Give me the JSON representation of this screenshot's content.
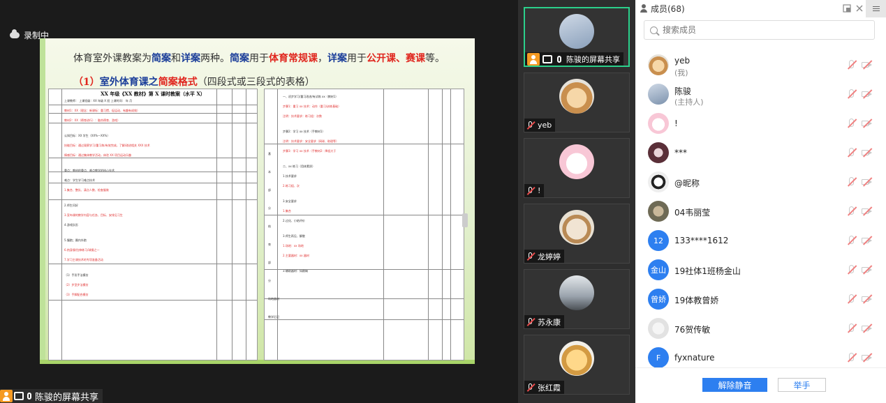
{
  "recording": {
    "label": "录制中"
  },
  "slide": {
    "line1": {
      "p1": "体育室外课教案为",
      "p2": "简案",
      "p3": "和",
      "p4": "详案",
      "p5": "两种。",
      "p6": "简案",
      "p7": "用于",
      "p8": "体育常规课",
      "p9": "，",
      "p10": "详案",
      "p11": "用于",
      "p12": "公开课、赛课",
      "p13": "等。"
    },
    "line2": {
      "p1": "（1）",
      "p2": "室外体育课之",
      "p3": "简案格式",
      "p4": "（四段式或三段式的表格）"
    },
    "doc_left_title": "XX 年级《XX 教材》第 X 课时教案（水平 X）",
    "doc_left_lines": [
      "上课教师：          上课班级：XX 年级 X 班          上课时间：   年   月",
      "教材1：XX（理念：新课标：重习惯、促运动、有趣有成效）",
      "教材2：XX（德育进行）：融合德育、游戏）",
      "认知目标：XX 学生（XX%—XX%）",
      "技能目标：通过观察学习/重习练/有效完成，了解/改进相关 XXX 技术",
      "情感目标：通过集体教学活动，体验 XX 项目运动乐趣",
      "重点：教材的重点、难点教学的核心技术",
      "难点：学生学习难点技术",
      "1.集合、整队、清点人数、检查服装",
      "2.师生问好",
      "3.宣布课的教学内容与任务、目标、安排见习生",
      "4.游戏队形",
      "5.慢跑；圈内外跑",
      "6.热身操/拉伸练习/球操之一",
      "7.学习主课技术的专项准备活动",
      "（1）手形手法模仿",
      "（2）步型步法模仿",
      "（3）手脚配合模仿"
    ],
    "doc_right_lines": [
      "一、初步学习/重习改进/有试练 xx（教材1）",
      "步骤1：重习 xx 技术：动作（重习/训练基础）",
      "注明：技术要求：练习组：次数",
      "步骤2：学习 xx 技术（手教材1）",
      "注明：技术要求：安全要求（网球、助理等）",
      "步骤3：学习 xx 技术（手教材2：降低大于",
      "二、xx 练习（用体素质）",
      "1.技术要求",
      "2.练习组、次",
      "3.安全要求",
      "1.集合",
      "2.过化、小结评价",
      "3.师生再见、解散",
      "1.场地：xx 场地",
      "2.主要器材：xx 器材",
      "3.辅助器材：如跳绳"
    ],
    "doc_right_side": [
      "基",
      "本",
      "部",
      "分",
      "结",
      "束",
      "部",
      "分",
      "场地器材",
      "教学后记"
    ]
  },
  "share_label": "陈骏的屏幕共享",
  "videos": [
    {
      "name": "陈骏的屏幕共享",
      "active": true
    },
    {
      "name": "yeb"
    },
    {
      "name": "!"
    },
    {
      "name": "龙婷婷"
    },
    {
      "name": "苏永康"
    },
    {
      "name": "张红霞"
    }
  ],
  "panel": {
    "title": "成员(68)",
    "search_placeholder": "搜索成员",
    "unmute_label": "解除静音",
    "raise_label": "举手"
  },
  "members": [
    {
      "name": "yeb",
      "sub": "(我)"
    },
    {
      "name": "陈骏",
      "sub": "(主持人)"
    },
    {
      "name": "!"
    },
    {
      "name": "***"
    },
    {
      "name": "@昵称"
    },
    {
      "name": "04韦丽莹"
    },
    {
      "name": "133****1612",
      "avatar_text": "12"
    },
    {
      "name": "19社体1班杨金山",
      "avatar_text": "金山"
    },
    {
      "name": "19体教曾娇",
      "avatar_text": "曾娇"
    },
    {
      "name": "76贺传敏"
    },
    {
      "name": "fyxnature",
      "avatar_text": "F"
    }
  ],
  "colors": {
    "accent": "#2d7ff0",
    "active_border": "#2bd08b",
    "share_orange": "#f59a23"
  }
}
